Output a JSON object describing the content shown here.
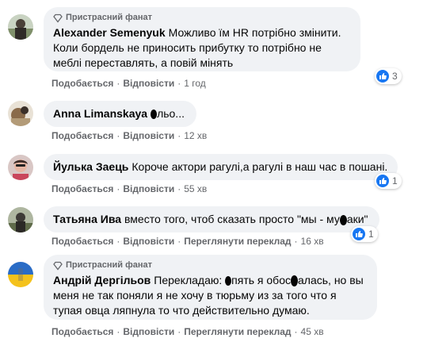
{
  "like_color": "#1877f2",
  "comments": [
    {
      "badge": "Пристрасний фанат",
      "author": "Alexander Semenyuk",
      "text": "Можливо їм HR потрібно змінити. Коли бордель не приносить прибутку то потрібно не меблі переставлять, а повій мінять",
      "actions": [
        "Подобається",
        "Відповісти"
      ],
      "time": "1 год",
      "reaction_count": "3"
    },
    {
      "author": "Anna Limanskaya",
      "text": "льо...",
      "actions": [
        "Подобається",
        "Відповісти"
      ],
      "time": "12 хв"
    },
    {
      "author": "Йулька Заець",
      "text": "Короче актори рагулі,а рагулі в наш час в пошані.",
      "actions": [
        "Подобається",
        "Відповісти"
      ],
      "time": "55 хв",
      "reaction_count": "1"
    },
    {
      "author": "Татьяна Ива",
      "text_before": "вместо того, чтоб сказать просто \"мы - му",
      "text_after": "аки\"",
      "actions": [
        "Подобається",
        "Відповісти",
        "Переглянути переклад"
      ],
      "time": "16 хв",
      "reaction_count": "1"
    },
    {
      "badge": "Пристрасний фанат",
      "author": "Андрій Дергільов",
      "text_1": "Перекладаю: ",
      "text_2": "пять я обос",
      "text_3": "алась, но вы меня не так поняли я не хочу в тюрьму из за того что я тупая овца ляпнула то что действительно думаю.",
      "actions": [
        "Подобається",
        "Відповісти",
        "Переглянути переклад"
      ],
      "time": "45 хв"
    }
  ]
}
